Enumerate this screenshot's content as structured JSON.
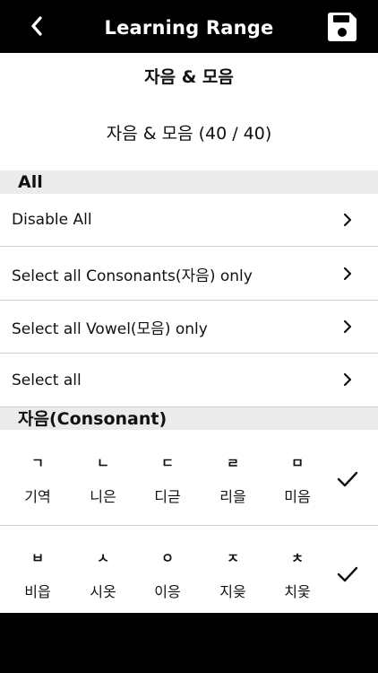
{
  "header": {
    "title": "Learning Range",
    "back_icon": "chevron-left-icon",
    "save_icon": "save-icon"
  },
  "subtitle": "자음 & 모음",
  "count": "자음 & 모음 (40 / 40)",
  "sections": {
    "all": {
      "label": "All"
    },
    "consonant": {
      "label": "자음(Consonant)"
    }
  },
  "options": [
    {
      "label": "Disable All"
    },
    {
      "label": "Select all Consonants(자음) only"
    },
    {
      "label": "Select all Vowel(모음) only"
    },
    {
      "label": "Select all"
    }
  ],
  "consonant_rows": [
    {
      "checked": true,
      "items": [
        {
          "jamo": "ㄱ",
          "name": "기역"
        },
        {
          "jamo": "ㄴ",
          "name": "니은"
        },
        {
          "jamo": "ㄷ",
          "name": "디귿"
        },
        {
          "jamo": "ㄹ",
          "name": "리을"
        },
        {
          "jamo": "ㅁ",
          "name": "미음"
        }
      ]
    },
    {
      "checked": true,
      "items": [
        {
          "jamo": "ㅂ",
          "name": "비읍"
        },
        {
          "jamo": "ㅅ",
          "name": "시옷"
        },
        {
          "jamo": "ㅇ",
          "name": "이응"
        },
        {
          "jamo": "ㅈ",
          "name": "지읒"
        },
        {
          "jamo": "ㅊ",
          "name": "치읓"
        }
      ]
    }
  ],
  "colors": {
    "header_bg": "#000000",
    "section_bg": "#ebebeb",
    "divider": "#cfcfcf"
  }
}
